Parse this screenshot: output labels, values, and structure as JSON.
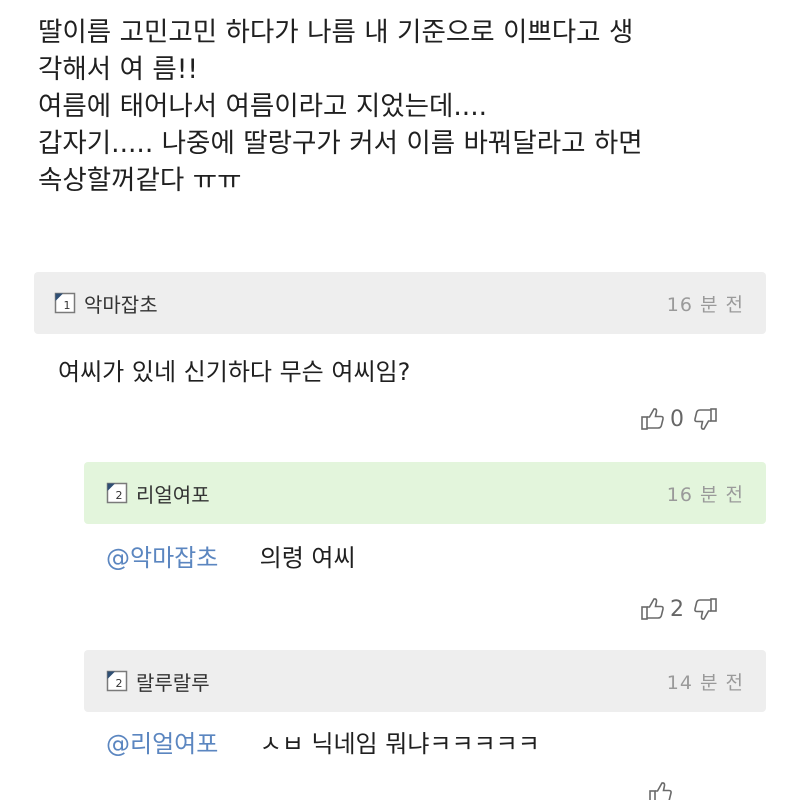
{
  "post": {
    "lines": [
      "딸이름 고민고민 하다가 나름 내 기준으로 이쁘다고 생",
      "각해서 여 름!!",
      "여름에 태어나서 여름이라고 지었는데....",
      "갑자기..... 나중에 딸랑구가 커서 이름 바꿔달라고 하면",
      "속상할꺼같다 ㅠㅠ"
    ]
  },
  "comments": [
    {
      "level": "1",
      "nickname": "악마잡초",
      "time": "16 분 전",
      "mention": "",
      "text": "여씨가 있네 신기하다 무슨 여씨임?",
      "likes": "0"
    },
    {
      "level": "2",
      "nickname": "리얼여포",
      "time": "16 분 전",
      "mention": "@악마잡초",
      "text": "의령 여씨",
      "likes": "2"
    },
    {
      "level": "2",
      "nickname": "랄루랄루",
      "time": "14 분 전",
      "mention": "@리얼여포",
      "text": "ㅅㅂ 닉네임 뭐냐ㅋㅋㅋㅋㅋ",
      "likes": ""
    }
  ],
  "colors": {
    "comment_header_bg": "#eeeeee",
    "author_reply_header_bg": "#e3f5dc",
    "mention": "#5b86c0",
    "timestamp": "#9a9a9a"
  },
  "icons": [
    "level-badge-icon",
    "thumbs-up-icon",
    "thumbs-down-icon"
  ]
}
